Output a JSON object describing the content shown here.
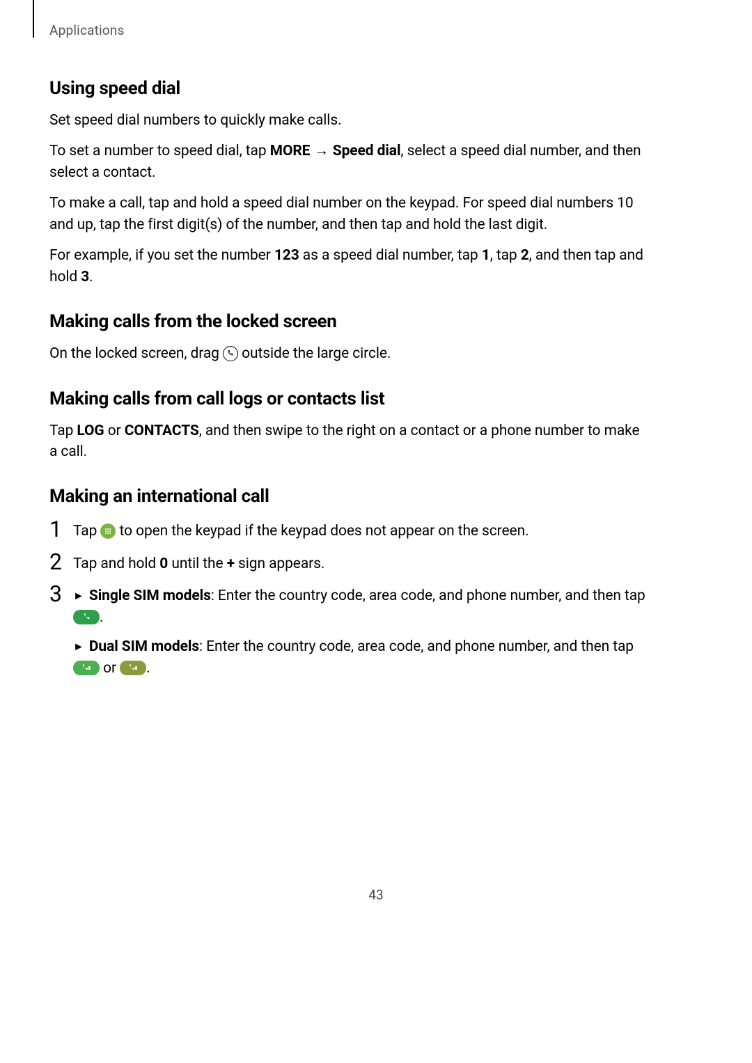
{
  "header": {
    "label": "Applications"
  },
  "sections": {
    "speed_dial": {
      "title": "Using speed dial",
      "p1": "Set speed dial numbers to quickly make calls.",
      "p2_a": "To set a number to speed dial, tap ",
      "p2_b": "MORE",
      "p2_arrow": " → ",
      "p2_c": "Speed dial",
      "p2_d": ", select a speed dial number, and then select a contact.",
      "p3": "To make a call, tap and hold a speed dial number on the keypad. For speed dial numbers 10 and up, tap the first digit(s) of the number, and then tap and hold the last digit.",
      "p4_a": "For example, if you set the number ",
      "p4_b": "123",
      "p4_c": " as a speed dial number, tap ",
      "p4_d": "1",
      "p4_e": ", tap ",
      "p4_f": "2",
      "p4_g": ", and then tap and hold ",
      "p4_h": "3",
      "p4_i": "."
    },
    "locked": {
      "title": "Making calls from the locked screen",
      "p1_a": "On the locked screen, drag ",
      "p1_b": " outside the large circle."
    },
    "logs": {
      "title": "Making calls from call logs or contacts list",
      "p1_a": "Tap ",
      "p1_b": "LOG",
      "p1_c": " or ",
      "p1_d": "CONTACTS",
      "p1_e": ", and then swipe to the right on a contact or a phone number to make a call."
    },
    "intl": {
      "title": "Making an international call",
      "steps": {
        "n1": "1",
        "s1_a": "Tap ",
        "s1_b": " to open the keypad if the keypad does not appear on the screen.",
        "n2": "2",
        "s2_a": "Tap and hold ",
        "s2_b": "0",
        "s2_c": " until the ",
        "s2_d": "+",
        "s2_e": " sign appears.",
        "n3": "3",
        "s3a_tri": "►",
        "s3a_label": "Single SIM models",
        "s3a_text": ": Enter the country code, area code, and phone number, and then tap ",
        "s3a_end": ".",
        "s3b_tri": "►",
        "s3b_label": "Dual SIM models",
        "s3b_text": ": Enter the country code, area code, and phone number, and then tap ",
        "s3b_or": " or ",
        "s3b_end": "."
      }
    }
  },
  "page_number": "43"
}
